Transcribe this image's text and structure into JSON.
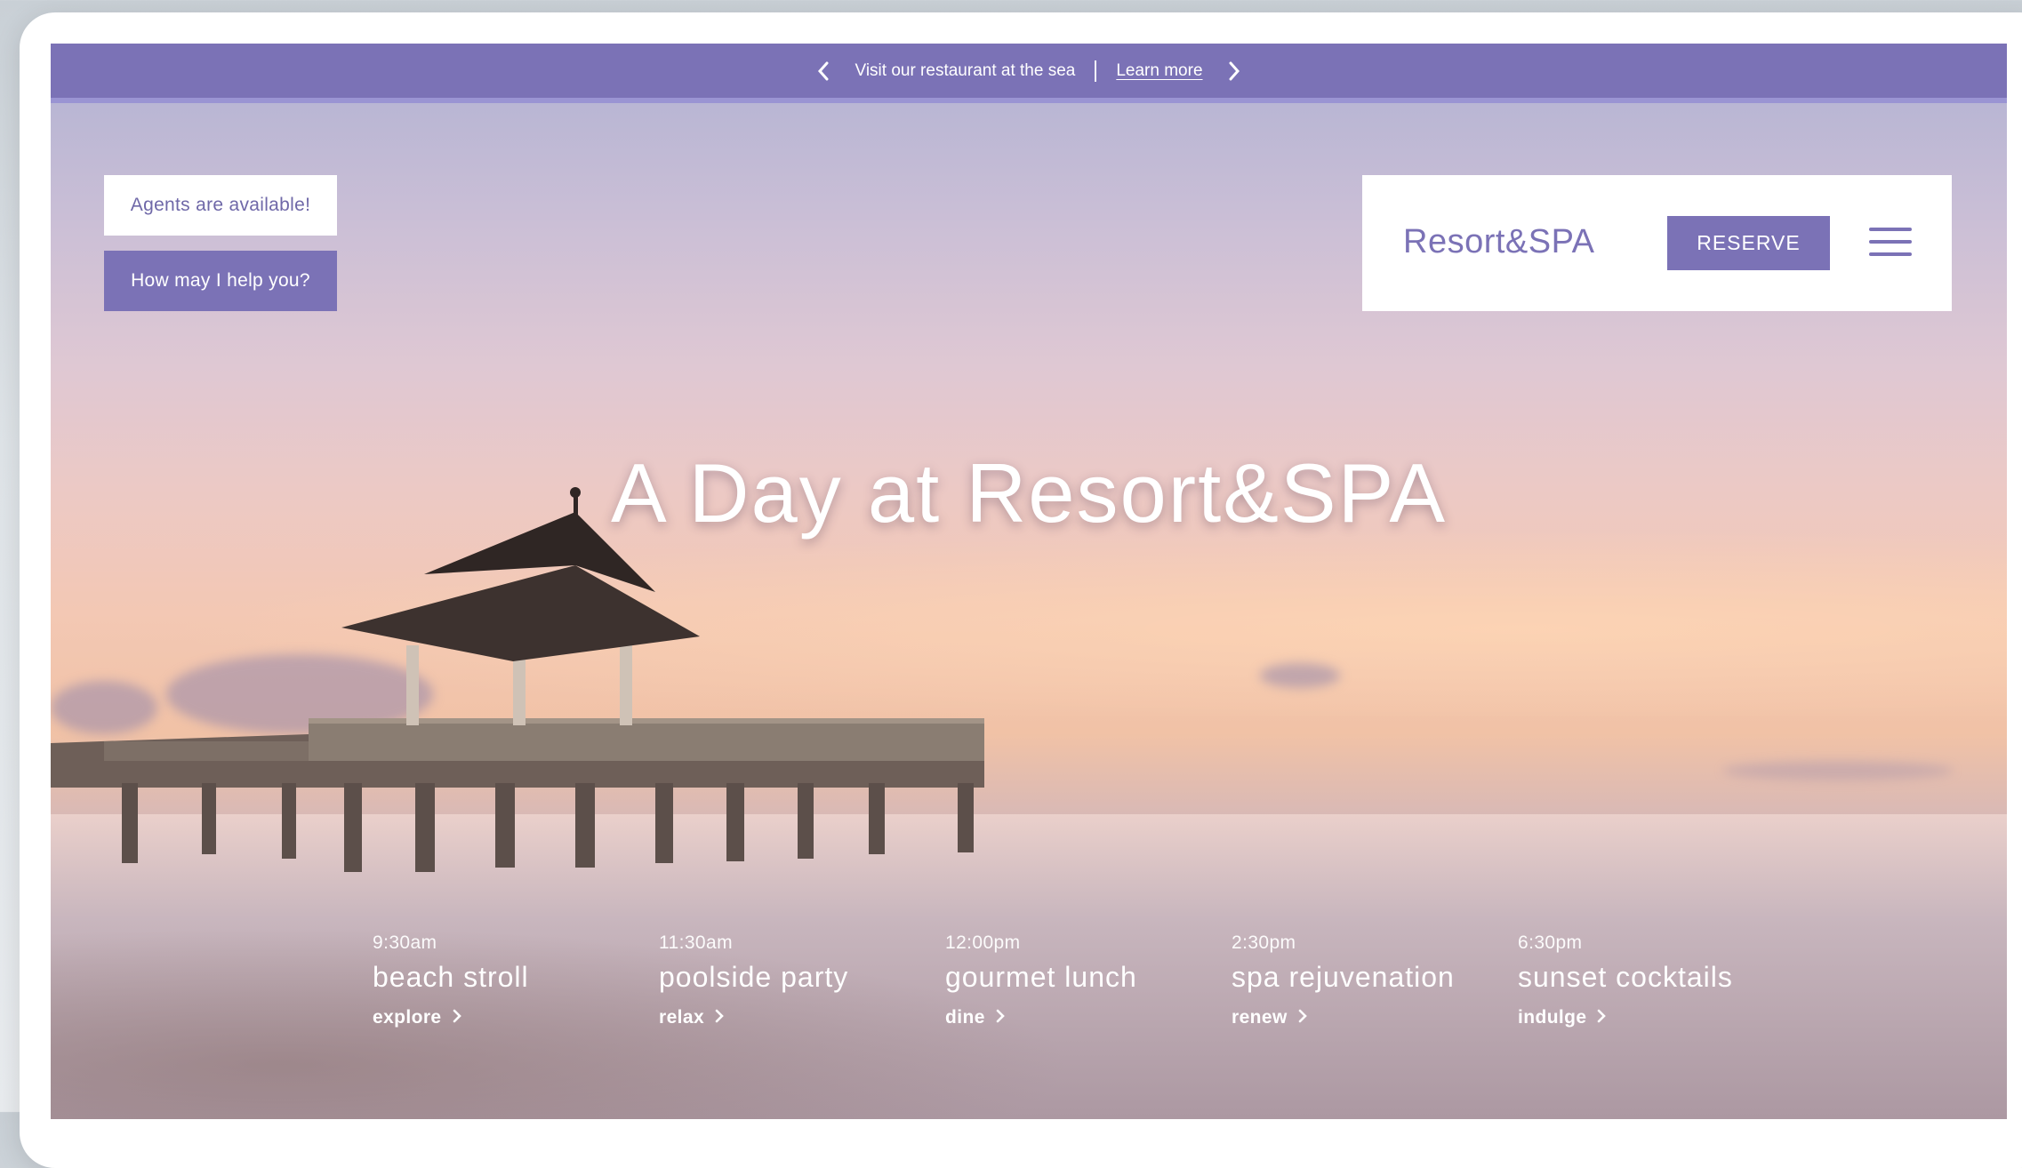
{
  "announcement": {
    "text": "Visit our restaurant at the sea",
    "link": "Learn more",
    "prev_icon": "chevron-left-icon",
    "next_icon": "chevron-right-icon"
  },
  "chat": {
    "status": "Agents are available!",
    "help": "How may I help you?"
  },
  "header": {
    "brand": "Resort&SPA",
    "reserve": "RESERVE",
    "menu_icon": "hamburger-menu-icon"
  },
  "hero": {
    "title": "A Day at Resort&SPA"
  },
  "schedule": [
    {
      "time": "9:30am",
      "name": "beach stroll",
      "link": "explore"
    },
    {
      "time": "11:30am",
      "name": "poolside party",
      "link": "relax"
    },
    {
      "time": "12:00pm",
      "name": "gourmet lunch",
      "link": "dine"
    },
    {
      "time": "2:30pm",
      "name": "spa rejuvenation",
      "link": "renew"
    },
    {
      "time": "6:30pm",
      "name": "sunset cocktails",
      "link": "indulge"
    }
  ],
  "colors": {
    "accent": "#7b72b6",
    "white": "#ffffff"
  }
}
